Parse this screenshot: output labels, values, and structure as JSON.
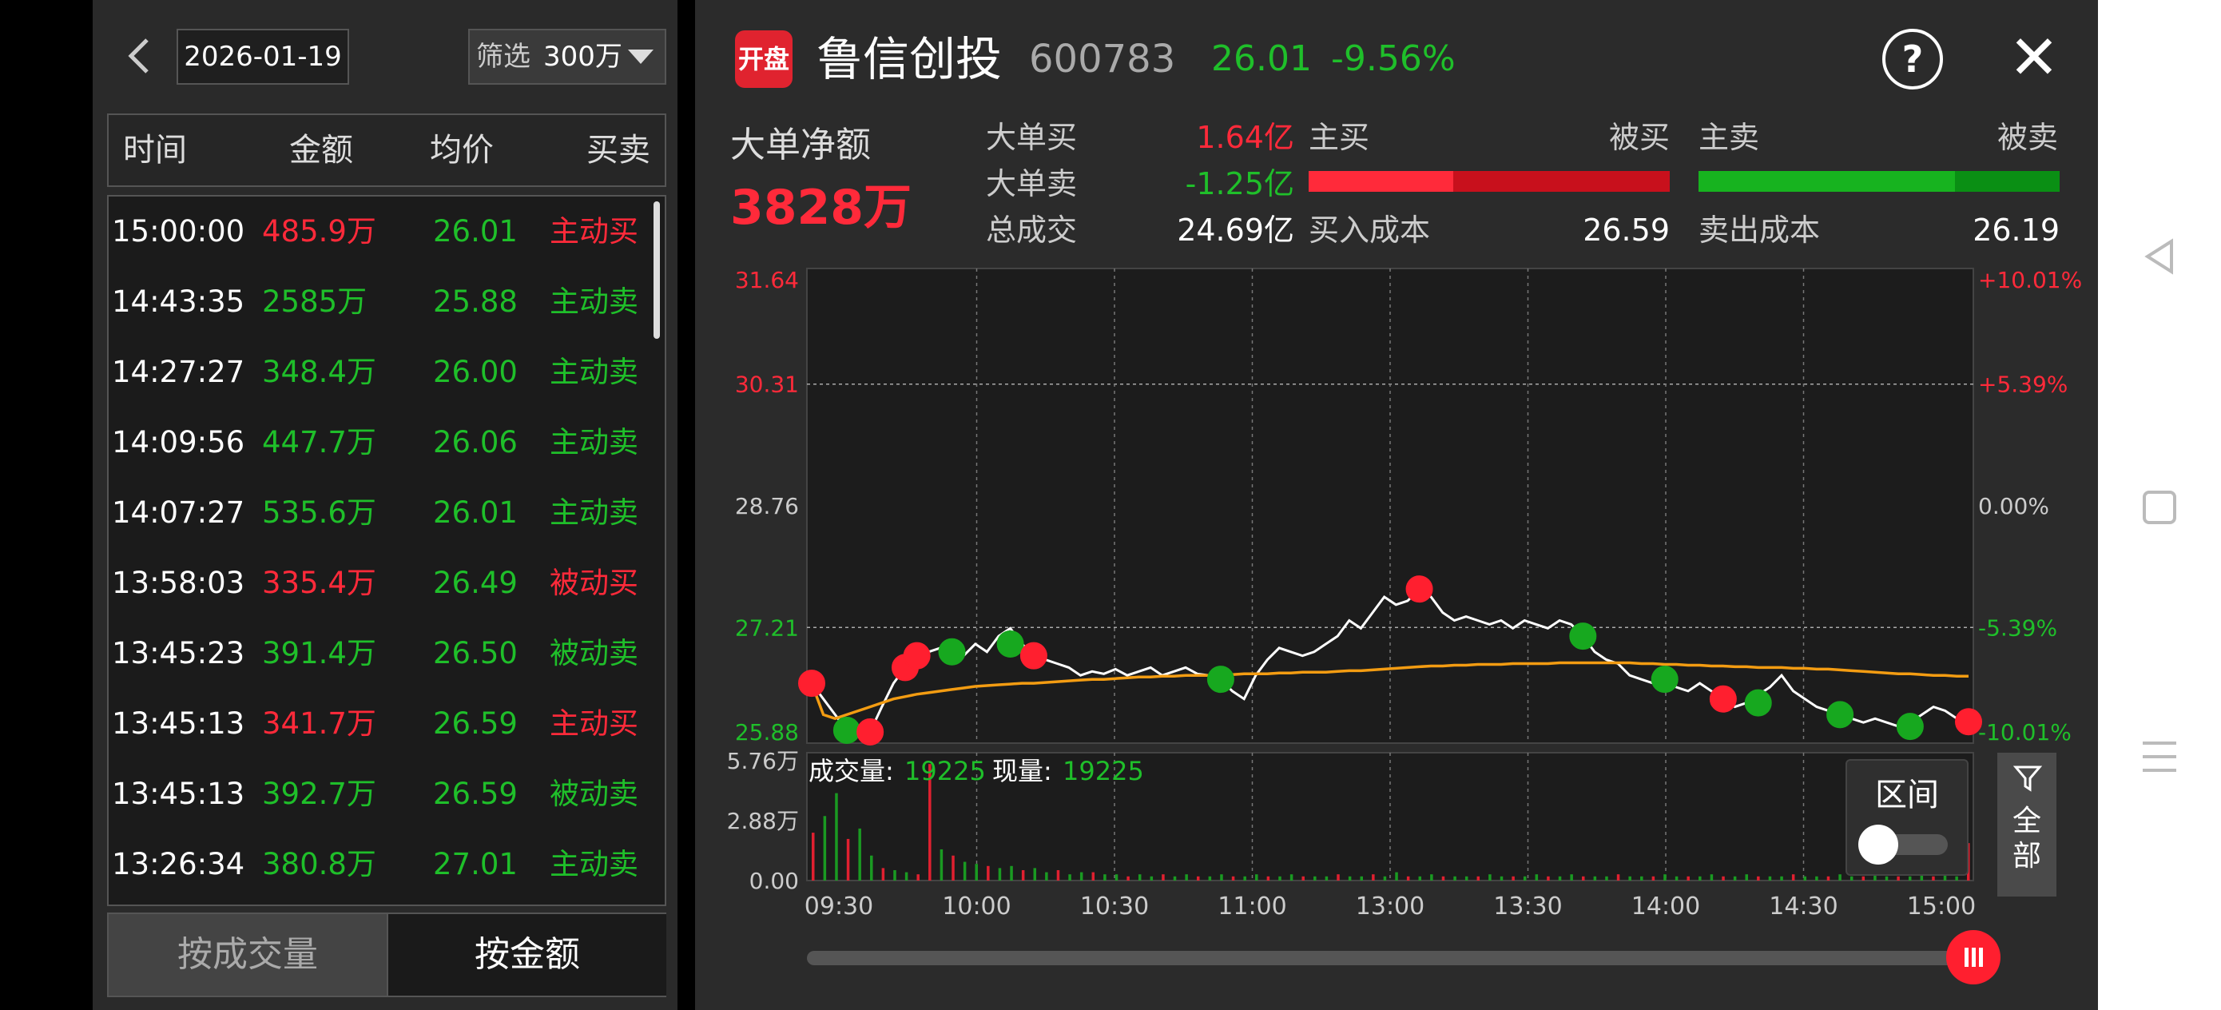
{
  "left": {
    "back_icon": "chevron-left-icon",
    "date": "2026-01-19",
    "filter_label": "筛选",
    "filter_value": "300万",
    "headers": [
      "时间",
      "金额",
      "均价",
      "买卖"
    ],
    "rows": [
      {
        "time": "15:00:00",
        "amount": "485.9万",
        "avg": "26.01",
        "type": "主动买",
        "color": "red"
      },
      {
        "time": "14:43:35",
        "amount": "2585万",
        "avg": "25.88",
        "type": "主动卖",
        "color": "green"
      },
      {
        "time": "14:27:27",
        "amount": "348.4万",
        "avg": "26.00",
        "type": "主动卖",
        "color": "green"
      },
      {
        "time": "14:09:56",
        "amount": "447.7万",
        "avg": "26.06",
        "type": "主动卖",
        "color": "green"
      },
      {
        "time": "14:07:27",
        "amount": "535.6万",
        "avg": "26.01",
        "type": "主动卖",
        "color": "green"
      },
      {
        "time": "13:58:03",
        "amount": "335.4万",
        "avg": "26.49",
        "type": "被动买",
        "color": "red"
      },
      {
        "time": "13:45:23",
        "amount": "391.4万",
        "avg": "26.50",
        "type": "被动卖",
        "color": "green"
      },
      {
        "time": "13:45:13",
        "amount": "341.7万",
        "avg": "26.59",
        "type": "主动买",
        "color": "red"
      },
      {
        "time": "13:45:13",
        "amount": "392.7万",
        "avg": "26.59",
        "type": "被动卖",
        "color": "green"
      },
      {
        "time": "13:26:34",
        "amount": "380.8万",
        "avg": "27.01",
        "type": "主动卖",
        "color": "green"
      }
    ],
    "tab_volume": "按成交量",
    "tab_amount": "按金额"
  },
  "header": {
    "logo_text": "开盘",
    "name": "鲁信创投",
    "code": "600783",
    "price": "26.01",
    "change": "-9.56%",
    "help_icon": "question-icon",
    "close_icon": "close-icon"
  },
  "stats": {
    "net_label": "大单净额",
    "net_value": "3828万",
    "big_buy_label": "大单买",
    "big_buy_value": "1.64亿",
    "big_sell_label": "大单卖",
    "big_sell_value": "-1.25亿",
    "total_label": "总成交",
    "total_value": "24.69亿",
    "active_buy": "主买",
    "passive_buy": "被买",
    "active_sell": "主卖",
    "passive_sell": "被卖",
    "buy_cost_label": "买入成本",
    "buy_cost_value": "26.59",
    "sell_cost_label": "卖出成本",
    "sell_cost_value": "26.19",
    "buy_bar_active_fraction": 0.4,
    "sell_bar_active_fraction": 0.71,
    "colors": {
      "buy_active": "#ff2a3a",
      "buy_passive": "#c8101c",
      "sell_active": "#17b31f",
      "sell_passive": "#0a8f14"
    }
  },
  "chart_data": {
    "type": "line",
    "price_axis": [
      "31.64",
      "30.31",
      "28.76",
      "27.21",
      "25.88"
    ],
    "pct_axis": [
      "+10.01%",
      "+5.39%",
      "0.00%",
      "-5.39%",
      "-10.01%"
    ],
    "ylim": [
      25.88,
      31.64
    ],
    "x_ticks": [
      "09:30",
      "10:00",
      "10:30",
      "11:00",
      "13:00",
      "13:30",
      "14:00",
      "14:30",
      "15:00"
    ],
    "series": [
      {
        "name": "price",
        "color": "#ffffff",
        "values": [
          26.5,
          26.3,
          26.1,
          25.9,
          25.88,
          25.88,
          26.2,
          26.5,
          26.7,
          26.85,
          26.9,
          26.95,
          26.9,
          26.85,
          27.0,
          26.9,
          27.1,
          27.2,
          27.0,
          26.85,
          26.8,
          26.75,
          26.7,
          26.6,
          26.65,
          26.62,
          26.68,
          26.6,
          26.65,
          26.7,
          26.6,
          26.65,
          26.7,
          26.62,
          26.6,
          26.55,
          26.4,
          26.3,
          26.6,
          26.8,
          26.95,
          26.9,
          26.85,
          26.9,
          27.0,
          27.1,
          27.3,
          27.2,
          27.4,
          27.6,
          27.5,
          27.55,
          27.7,
          27.6,
          27.4,
          27.3,
          27.35,
          27.3,
          27.25,
          27.3,
          27.2,
          27.3,
          27.25,
          27.2,
          27.3,
          27.25,
          27.1,
          26.9,
          26.8,
          26.75,
          26.6,
          26.55,
          26.5,
          26.55,
          26.45,
          26.4,
          26.5,
          26.4,
          26.3,
          26.2,
          26.25,
          26.35,
          26.45,
          26.6,
          26.4,
          26.3,
          26.2,
          26.15,
          26.1,
          26.05,
          26.0,
          26.05,
          26.0,
          25.95,
          26.0,
          26.1,
          26.2,
          26.15,
          26.05,
          26.01
        ]
      },
      {
        "name": "average",
        "color": "#f39c12",
        "values": [
          26.5,
          26.1,
          26.05,
          26.1,
          26.15,
          26.2,
          26.25,
          26.3,
          26.33,
          26.36,
          26.38,
          26.4,
          26.42,
          26.44,
          26.46,
          26.47,
          26.48,
          26.49,
          26.5,
          26.5,
          26.51,
          26.52,
          26.53,
          26.54,
          26.55,
          26.55,
          26.56,
          26.57,
          26.58,
          26.58,
          26.59,
          26.59,
          26.6,
          26.6,
          26.6,
          26.61,
          26.61,
          26.62,
          26.62,
          26.62,
          26.63,
          26.63,
          26.64,
          26.64,
          26.64,
          26.65,
          26.66,
          26.66,
          26.67,
          26.68,
          26.69,
          26.7,
          26.71,
          26.72,
          26.72,
          26.73,
          26.73,
          26.74,
          26.74,
          26.74,
          26.75,
          26.75,
          26.75,
          26.75,
          26.76,
          26.76,
          26.76,
          26.76,
          26.76,
          26.76,
          26.76,
          26.75,
          26.75,
          26.74,
          26.74,
          26.73,
          26.73,
          26.72,
          26.72,
          26.71,
          26.71,
          26.7,
          26.7,
          26.7,
          26.69,
          26.69,
          26.68,
          26.68,
          26.67,
          26.66,
          26.65,
          26.64,
          26.63,
          26.62,
          26.62,
          26.61,
          26.6,
          26.6,
          26.59,
          26.59
        ]
      }
    ],
    "markers": [
      {
        "i": 0,
        "y": 26.5,
        "color": "red"
      },
      {
        "i": 3,
        "y": 25.9,
        "color": "green"
      },
      {
        "i": 5,
        "y": 25.88,
        "color": "red"
      },
      {
        "i": 8,
        "y": 26.7,
        "color": "red"
      },
      {
        "i": 9,
        "y": 26.85,
        "color": "red"
      },
      {
        "i": 12,
        "y": 26.9,
        "color": "green"
      },
      {
        "i": 17,
        "y": 27.0,
        "color": "green"
      },
      {
        "i": 19,
        "y": 26.85,
        "color": "red"
      },
      {
        "i": 35,
        "y": 26.55,
        "color": "green"
      },
      {
        "i": 52,
        "y": 27.7,
        "color": "red"
      },
      {
        "i": 66,
        "y": 27.1,
        "color": "green"
      },
      {
        "i": 73,
        "y": 26.55,
        "color": "green"
      },
      {
        "i": 78,
        "y": 26.3,
        "color": "red"
      },
      {
        "i": 81,
        "y": 26.25,
        "color": "green"
      },
      {
        "i": 88,
        "y": 26.1,
        "color": "green"
      },
      {
        "i": 94,
        "y": 25.95,
        "color": "green"
      },
      {
        "i": 99,
        "y": 26.01,
        "color": "red"
      }
    ],
    "volume": {
      "axis": [
        "5.76万",
        "2.88万",
        "0.00"
      ],
      "ylim": [
        0,
        5.76
      ],
      "label": "成交量:",
      "value": "19225",
      "cur_label": "现量:",
      "cur_value": "19225",
      "bars": [
        2.3,
        3.1,
        4.2,
        2.0,
        2.5,
        1.2,
        0.6,
        0.5,
        0.4,
        0.3,
        5.6,
        1.5,
        1.2,
        0.9,
        0.8,
        0.7,
        0.6,
        0.7,
        0.5,
        0.6,
        0.4,
        0.5,
        0.3,
        0.4,
        0.4,
        0.3,
        0.3,
        0.2,
        0.3,
        0.2,
        0.3,
        0.2,
        0.3,
        0.2,
        0.2,
        0.3,
        0.2,
        0.2,
        0.3,
        0.2,
        0.2,
        0.3,
        0.2,
        0.2,
        0.2,
        0.3,
        0.2,
        0.2,
        0.3,
        0.2,
        0.4,
        0.2,
        0.2,
        0.3,
        0.2,
        0.2,
        0.2,
        0.2,
        0.3,
        0.2,
        0.2,
        0.2,
        0.3,
        0.2,
        0.2,
        0.3,
        0.2,
        0.2,
        0.2,
        0.3,
        0.2,
        0.2,
        0.2,
        0.3,
        0.2,
        0.2,
        0.2,
        0.3,
        0.2,
        0.2,
        0.3,
        0.2,
        0.2,
        0.2,
        0.3,
        0.2,
        0.2,
        0.2,
        0.3,
        0.2,
        0.2,
        0.3,
        0.2,
        0.2,
        0.2,
        0.3,
        0.2,
        0.3,
        0.2,
        1.8
      ]
    },
    "range_label": "区间",
    "all_label_1": "全",
    "all_label_2": "部",
    "filter_icon": "funnel-icon"
  }
}
